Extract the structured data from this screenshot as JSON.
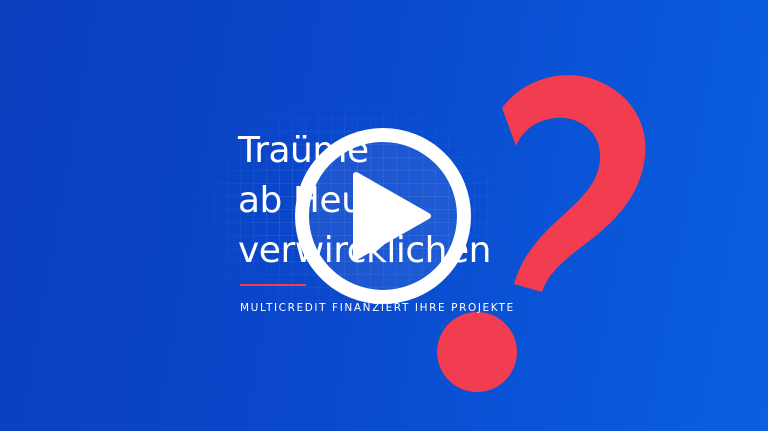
{
  "video": {
    "headline": [
      "Traüme",
      "ab Heute",
      "verwircklichen"
    ],
    "tagline": "MULTICREDIT FINANZIERT IHRE PROJEKTE",
    "play_icon": "play-icon",
    "decoration_icon": "question-mark-icon"
  },
  "colors": {
    "background": "#0a48cc",
    "accent": "#f23c4f",
    "text": "#ffffff"
  }
}
